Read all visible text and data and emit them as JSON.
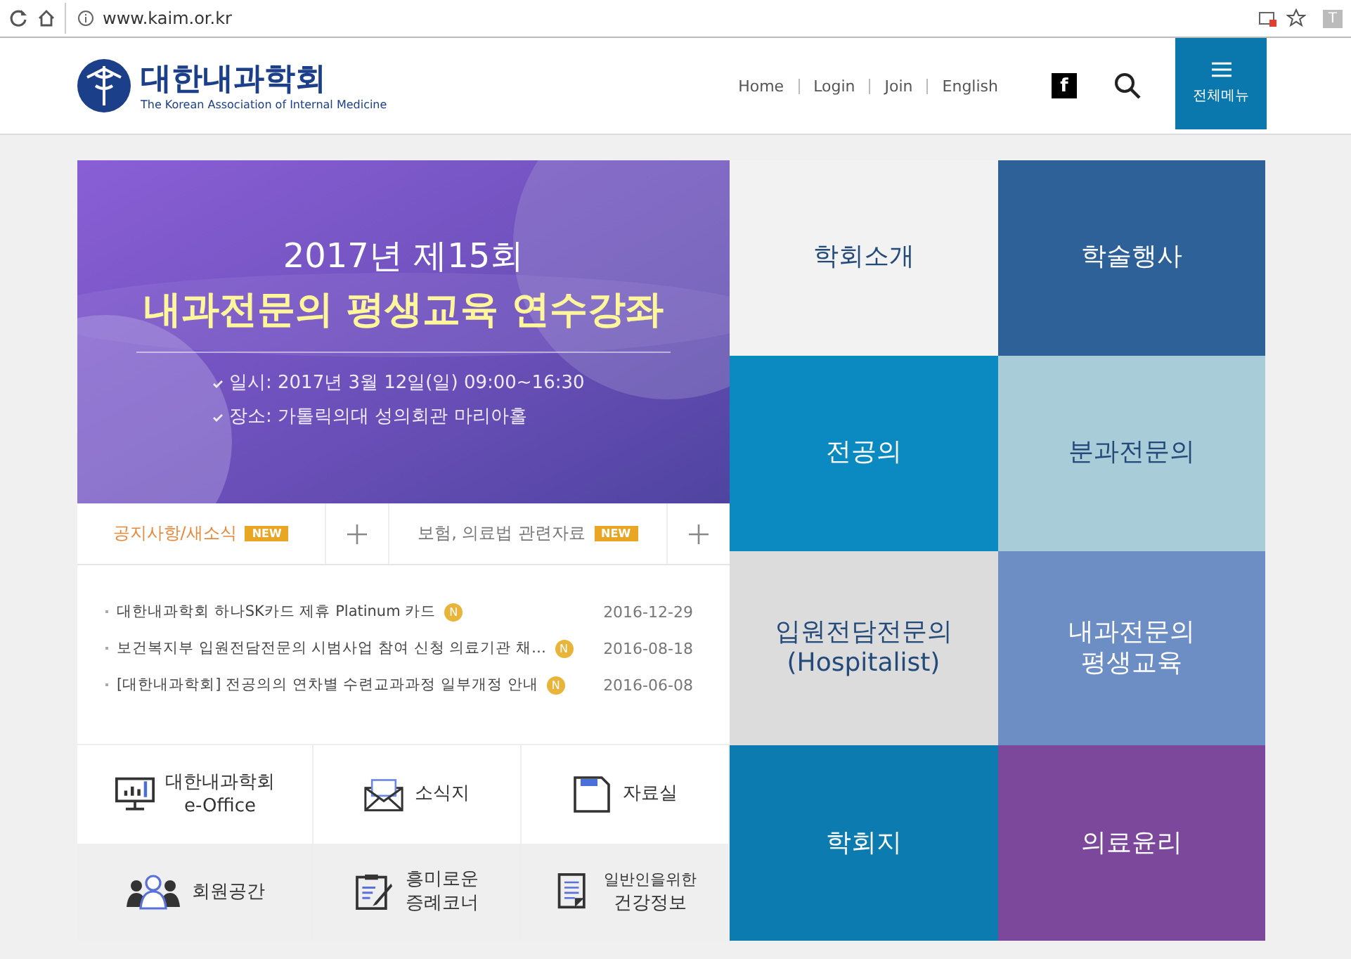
{
  "browser": {
    "url": "www.kaim.or.kr",
    "profile": "T"
  },
  "header": {
    "logo_title": "대한내과학회",
    "logo_subtitle": "The Korean Association of Internal Medicine",
    "links": [
      "Home",
      "Login",
      "Join",
      "English"
    ],
    "facebook": "f",
    "menu_label": "전체메뉴"
  },
  "banner": {
    "line_1": "2017년 제15회",
    "line_2": "내과전문의 평생교육 연수강좌",
    "details": [
      "일시: 2017년 3월 12일(일) 09:00~16:30",
      "장소: 가톨릭의대 성의회관 마리아홀"
    ]
  },
  "tabs": [
    {
      "label": "공지사항/새소식",
      "badge": "NEW",
      "selected": true
    },
    {
      "label": "보험, 의료법 관련자료",
      "badge": "NEW",
      "selected": false
    }
  ],
  "news": [
    {
      "title": "대한내과학회 하나SK카드 제휴 Platinum 카드",
      "badge": "N",
      "date": "2016-12-29"
    },
    {
      "title": "보건복지부 입원전담전문의 시범사업 참여 신청 의료기관 채…",
      "badge": "N",
      "date": "2016-08-18"
    },
    {
      "title": "[대한내과학회] 전공의의 연차별 수련교과과정 일부개정 안내",
      "badge": "N",
      "date": "2016-06-08"
    }
  ],
  "quick_links": [
    {
      "kind": "monitor",
      "lines": [
        "대한내과학회",
        "e-Office"
      ]
    },
    {
      "kind": "envelope",
      "lines": [
        "소식지"
      ]
    },
    {
      "kind": "floppy",
      "lines": [
        "자료실"
      ]
    },
    {
      "kind": "people",
      "lines": [
        "회원공간"
      ]
    },
    {
      "kind": "clipboard",
      "lines": [
        "흥미로운",
        "증례코너"
      ]
    },
    {
      "kind": "document",
      "lines": [
        "일반인을위한",
        "건강정보"
      ]
    }
  ],
  "tiles": [
    {
      "lines": [
        "학회소개"
      ],
      "color": "#f2f2f2",
      "kind": "light"
    },
    {
      "lines": [
        "학술행사"
      ],
      "color": "#2f6199",
      "kind": "dark"
    },
    {
      "lines": [
        "전공의"
      ],
      "color": "#0a8ac0",
      "kind": "dark"
    },
    {
      "lines": [
        "분과전문의"
      ],
      "color": "#a8cdd9",
      "kind": "light"
    },
    {
      "lines": [
        "입원전담전문의",
        "(Hospitalist)"
      ],
      "color": "#dcdcdc",
      "kind": "light"
    },
    {
      "lines": [
        "내과전문의",
        "평생교육"
      ],
      "color": "#6d8ec4",
      "kind": "dark"
    },
    {
      "lines": [
        "학회지"
      ],
      "color": "#0c7cb0",
      "kind": "dark"
    },
    {
      "lines": [
        "의료윤리"
      ],
      "color": "#7b489c",
      "kind": "dark"
    }
  ]
}
